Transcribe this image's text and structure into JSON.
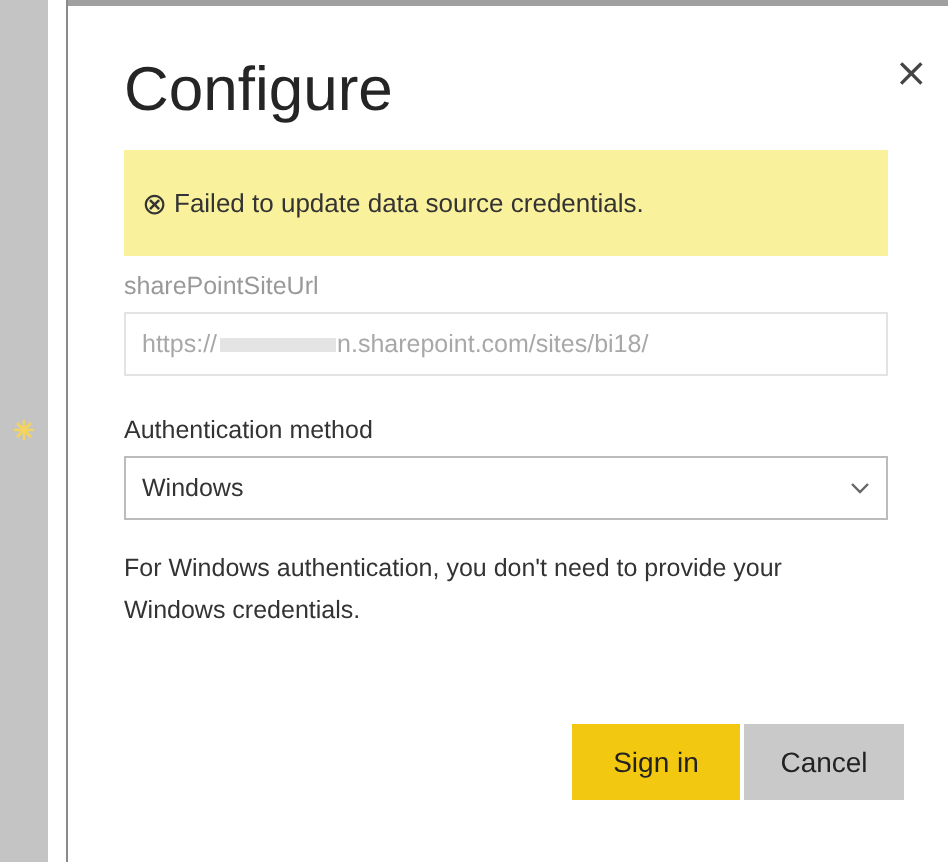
{
  "dialog": {
    "title": "Configure",
    "close": "×"
  },
  "error_banner": {
    "icon": "⊗",
    "message": "Failed to update data source credentials."
  },
  "url_field": {
    "label": "sharePointSiteUrl",
    "value_start": "https://",
    "value_end": "n.sharepoint.com/sites/bi18/",
    "disabled": true
  },
  "auth_field": {
    "label": "Authentication method",
    "value": "Windows"
  },
  "help_text": "For Windows authentication, you don't need to provide your Windows credentials.",
  "buttons": [
    {
      "label": "Sign in",
      "kind": "primary"
    },
    {
      "label": "Cancel",
      "kind": "secondary"
    }
  ]
}
